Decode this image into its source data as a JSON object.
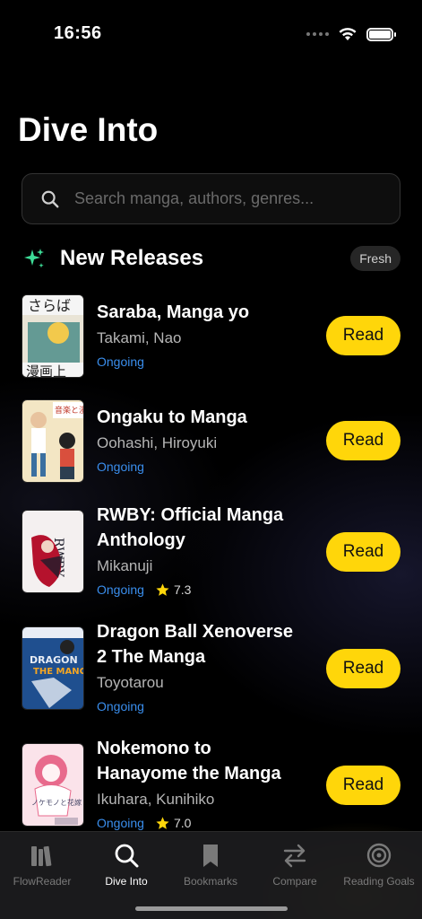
{
  "status_bar": {
    "time": "16:56"
  },
  "page": {
    "title": "Dive Into"
  },
  "search": {
    "placeholder": "Search manga, authors, genres..."
  },
  "section": {
    "title": "New Releases",
    "badge": "Fresh"
  },
  "manga": [
    {
      "title": "Saraba, Manga yo",
      "author": "Takami, Nao",
      "status": "Ongoing",
      "rating": null,
      "action": "Read",
      "cover_colors": [
        "#e9e4d6",
        "#2b7a78",
        "#f2c94c"
      ]
    },
    {
      "title": "Ongaku to Manga",
      "author": "Oohashi, Hiroyuki",
      "status": "Ongoing",
      "rating": null,
      "action": "Read",
      "cover_colors": [
        "#f3e6c4",
        "#3b6fa0",
        "#d94f3d"
      ]
    },
    {
      "title": "RWBY: Official Manga Anthology",
      "author": "Mikanuji",
      "status": "Ongoing",
      "rating": "7.3",
      "action": "Read",
      "cover_colors": [
        "#f4f0f0",
        "#b5122d",
        "#1d1d2b"
      ]
    },
    {
      "title": "Dragon Ball Xenoverse 2 The Manga",
      "author": "Toyotarou",
      "status": "Ongoing",
      "rating": null,
      "action": "Read",
      "cover_colors": [
        "#1f4f8f",
        "#e8edf5",
        "#f5a623"
      ]
    },
    {
      "title": "Nokemono to Hanayome the Manga",
      "author": "Ikuhara, Kunihiko",
      "status": "Ongoing",
      "rating": "7.0",
      "action": "Read",
      "cover_colors": [
        "#fbe3ea",
        "#e86a8c",
        "#4a4a6a"
      ]
    }
  ],
  "tabs": [
    {
      "label": "FlowReader",
      "icon": "library-icon",
      "active": false
    },
    {
      "label": "Dive Into",
      "icon": "search-icon",
      "active": true
    },
    {
      "label": "Bookmarks",
      "icon": "bookmark-icon",
      "active": false
    },
    {
      "label": "Compare",
      "icon": "compare-arrows-icon",
      "active": false
    },
    {
      "label": "Reading Goals",
      "icon": "target-icon",
      "active": false
    }
  ],
  "colors": {
    "accent": "#ffd60a",
    "status": "#3a8eed",
    "sparkle": "#3ddc97"
  }
}
